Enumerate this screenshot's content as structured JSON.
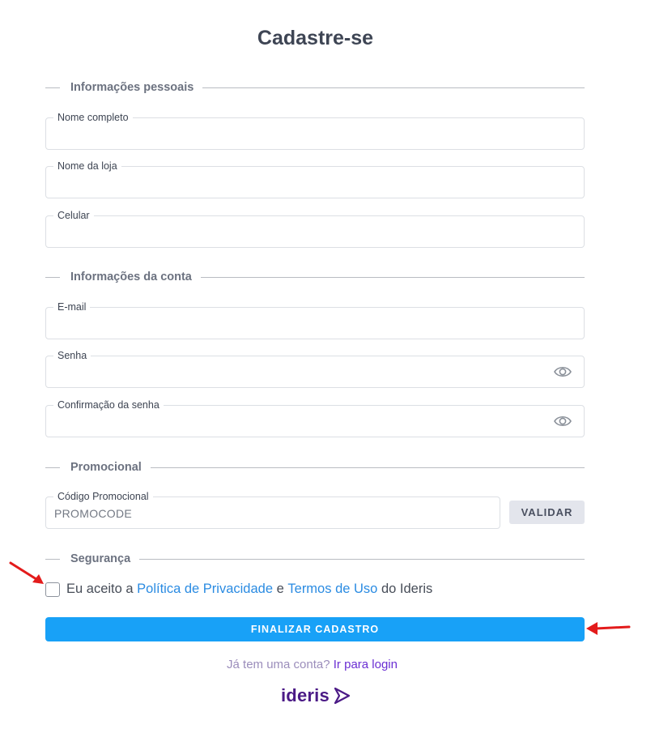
{
  "page": {
    "title": "Cadastre-se"
  },
  "sections": {
    "personal": "Informações pessoais",
    "account": "Informações da conta",
    "promo": "Promocional",
    "security": "Segurança"
  },
  "fields": {
    "full_name": {
      "label": "Nome completo",
      "value": ""
    },
    "store_name": {
      "label": "Nome da loja",
      "value": ""
    },
    "phone": {
      "label": "Celular",
      "value": ""
    },
    "email": {
      "label": "E-mail",
      "value": ""
    },
    "password": {
      "label": "Senha",
      "value": "",
      "icon": "eye-icon"
    },
    "password_confirm": {
      "label": "Confirmação da senha",
      "value": "",
      "icon": "eye-icon"
    },
    "promo_code": {
      "label": "Código Promocional",
      "value": "PROMOCODE"
    }
  },
  "promo": {
    "validate_label": "VALIDAR"
  },
  "terms": {
    "prefix": "Eu aceito a",
    "privacy_link": "Política de Privacidade",
    "connector": "e",
    "terms_link": "Termos de Uso",
    "suffix": "do Ideris",
    "checked": false
  },
  "submit": {
    "label": "FINALIZAR CADASTRO"
  },
  "login": {
    "question": "Já tem uma conta?",
    "link": "Ir para login"
  },
  "logo": {
    "text": "ideris"
  },
  "colors": {
    "primary_button": "#18a1f7",
    "link": "#2a8be2",
    "login_link": "#6b2fd3",
    "brand": "#4b1a86",
    "annotation_arrow": "#e31b1b"
  }
}
